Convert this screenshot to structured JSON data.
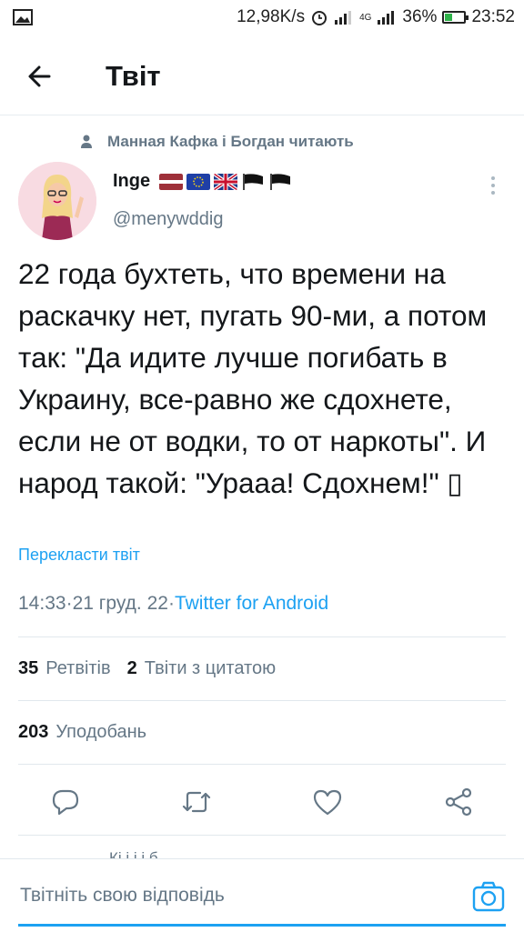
{
  "status_bar": {
    "speed": "12,98K/s",
    "network": "4G",
    "battery": "36%",
    "battery_level": 0.36,
    "time": "23:52"
  },
  "header": {
    "title": "Твіт",
    "back_icon": "arrow-left-icon"
  },
  "context": {
    "text": "Манная Кафка і Богдан читають",
    "icon": "person-icon"
  },
  "author": {
    "name": "Inge",
    "handle": "@menywddig",
    "flags": [
      "latvia-flag",
      "eu-flag",
      "uk-flag",
      "black-flag",
      "black-flag"
    ]
  },
  "tweet": {
    "text": "22 года бухтеть, что времени на раскачку нет, пугать 90-ми, а потом так: \"Да идите лучше погибать в Украину, все-равно же сдохнете, если не от водки, то от наркоты\". И народ такой: \"Урааа! Сдохнем!\" ▯",
    "translate": "Перекласти твіт",
    "time": "14:33",
    "date": "21 груд. 22",
    "separator": " · ",
    "source": "Twitter for Android"
  },
  "stats": {
    "retweets_count": "35",
    "retweets_label": "Ретвітів",
    "quotes_count": "2",
    "quotes_label": "Твіти з цитатою",
    "likes_count": "203",
    "likes_label": "Уподобань"
  },
  "actions": [
    "reply-icon",
    "retweet-icon",
    "like-icon",
    "share-icon"
  ],
  "peek_text": "Кі                  і і          і              б",
  "reply": {
    "placeholder": "Твітніть свою відповідь",
    "camera_icon": "camera-icon"
  },
  "colors": {
    "accent": "#1da1f2",
    "secondary_text": "#657786",
    "primary_text": "#14171a"
  }
}
